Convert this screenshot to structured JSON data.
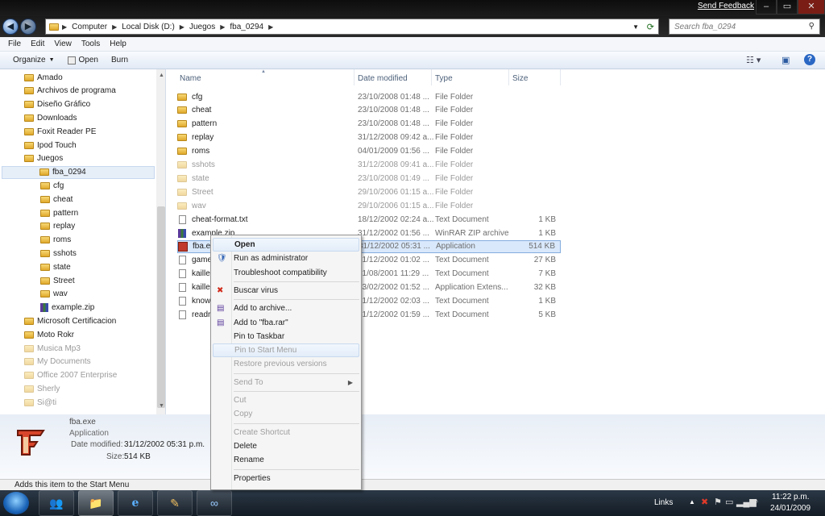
{
  "window": {
    "feedback": "Send Feedback",
    "controls": [
      "–",
      "▭",
      "✕"
    ]
  },
  "address": {
    "crumbs": [
      "Computer",
      "Local Disk (D:)",
      "Juegos",
      "fba_0294"
    ],
    "search_placeholder": "Search fba_0294"
  },
  "menu": [
    "File",
    "Edit",
    "View",
    "Tools",
    "Help"
  ],
  "toolbar": {
    "organize": "Organize",
    "open": "Open",
    "burn": "Burn"
  },
  "nav": [
    {
      "label": "Amado",
      "depth": 0
    },
    {
      "label": "Archivos de programa",
      "depth": 0
    },
    {
      "label": "Diseño Gráfico",
      "depth": 0
    },
    {
      "label": "Downloads",
      "depth": 0
    },
    {
      "label": "Foxit Reader PE",
      "depth": 0
    },
    {
      "label": "Ipod Touch",
      "depth": 0
    },
    {
      "label": "Juegos",
      "depth": 0
    },
    {
      "label": "fba_0294",
      "depth": 1,
      "selected": true
    },
    {
      "label": "cfg",
      "depth": 2
    },
    {
      "label": "cheat",
      "depth": 2
    },
    {
      "label": "pattern",
      "depth": 2
    },
    {
      "label": "replay",
      "depth": 2
    },
    {
      "label": "roms",
      "depth": 2
    },
    {
      "label": "sshots",
      "depth": 2
    },
    {
      "label": "state",
      "depth": 2
    },
    {
      "label": "Street",
      "depth": 2
    },
    {
      "label": "wav",
      "depth": 2
    },
    {
      "label": "example.zip",
      "depth": 2,
      "zip": true
    },
    {
      "label": "Microsoft Certificacion",
      "depth": 0
    },
    {
      "label": "Moto Rokr",
      "depth": 0
    },
    {
      "label": "Musica Mp3",
      "depth": 0,
      "dim": true
    },
    {
      "label": "My Documents",
      "depth": 0,
      "dim": true
    },
    {
      "label": "Office 2007 Enterprise",
      "depth": 0,
      "dim": true
    },
    {
      "label": "Sherly",
      "depth": 0,
      "dim": true
    },
    {
      "label": "Si@ti",
      "depth": 0,
      "dim": true
    }
  ],
  "columns": {
    "name": "Name",
    "date": "Date modified",
    "type": "Type",
    "size": "Size"
  },
  "files": [
    {
      "name": "cfg",
      "date": "23/10/2008 01:48 ...",
      "type": "File Folder",
      "size": "",
      "kind": "folder"
    },
    {
      "name": "cheat",
      "date": "23/10/2008 01:48 ...",
      "type": "File Folder",
      "size": "",
      "kind": "folder"
    },
    {
      "name": "pattern",
      "date": "23/10/2008 01:48 ...",
      "type": "File Folder",
      "size": "",
      "kind": "folder"
    },
    {
      "name": "replay",
      "date": "31/12/2008 09:42 a...",
      "type": "File Folder",
      "size": "",
      "kind": "folder"
    },
    {
      "name": "roms",
      "date": "04/01/2009 01:56 ...",
      "type": "File Folder",
      "size": "",
      "kind": "folder"
    },
    {
      "name": "sshots",
      "date": "31/12/2008 09:41 a...",
      "type": "File Folder",
      "size": "",
      "kind": "folder",
      "dim": true
    },
    {
      "name": "state",
      "date": "23/10/2008 01:49 ...",
      "type": "File Folder",
      "size": "",
      "kind": "folder",
      "dim": true
    },
    {
      "name": "Street",
      "date": "29/10/2006 01:15 a...",
      "type": "File Folder",
      "size": "",
      "kind": "folder",
      "dim": true
    },
    {
      "name": "wav",
      "date": "29/10/2006 01:15 a...",
      "type": "File Folder",
      "size": "",
      "kind": "folder",
      "dim": true
    },
    {
      "name": "cheat-format.txt",
      "date": "18/12/2002 02:24 a...",
      "type": "Text Document",
      "size": "1 KB",
      "kind": "doc"
    },
    {
      "name": "example.zip",
      "date": "31/12/2002 01:56 ...",
      "type": "WinRAR ZIP archive",
      "size": "1 KB",
      "kind": "zip"
    },
    {
      "name": "fba.e",
      "date": "31/12/2002 05:31 ...",
      "type": "Application",
      "size": "514 KB",
      "kind": "app",
      "selected": true
    },
    {
      "name": "game",
      "date": "31/12/2002 01:02 ...",
      "type": "Text Document",
      "size": "27 KB",
      "kind": "doc"
    },
    {
      "name": "kaille",
      "date": "31/08/2001 11:29 ...",
      "type": "Text Document",
      "size": "7 KB",
      "kind": "doc"
    },
    {
      "name": "kaille",
      "date": "23/02/2002 01:52 ...",
      "type": "Application Extens...",
      "size": "32 KB",
      "kind": "doc"
    },
    {
      "name": "know",
      "date": "31/12/2002 02:03 ...",
      "type": "Text Document",
      "size": "1 KB",
      "kind": "doc"
    },
    {
      "name": "readr",
      "date": "31/12/2002 01:59 ...",
      "type": "Text Document",
      "size": "5 KB",
      "kind": "doc"
    }
  ],
  "context_menu": [
    {
      "label": "Open",
      "bold": true,
      "hover": true
    },
    {
      "label": "Run as administrator",
      "icon": "shield"
    },
    {
      "label": "Troubleshoot compatibility"
    },
    {
      "sep": true
    },
    {
      "label": "Buscar virus",
      "icon": "virus"
    },
    {
      "sep": true
    },
    {
      "label": "Add to archive...",
      "icon": "rar"
    },
    {
      "label": "Add to \"fba.rar\"",
      "icon": "rar"
    },
    {
      "label": "Pin to Taskbar"
    },
    {
      "label": "Pin to Start Menu",
      "disabled": true,
      "hover": true
    },
    {
      "label": "Restore previous versions",
      "disabled": true
    },
    {
      "sep": true
    },
    {
      "label": "Send To",
      "disabled": true,
      "submenu": true
    },
    {
      "sep": true
    },
    {
      "label": "Cut",
      "disabled": true
    },
    {
      "label": "Copy",
      "disabled": true
    },
    {
      "sep": true
    },
    {
      "label": "Create Shortcut",
      "disabled": true
    },
    {
      "label": "Delete"
    },
    {
      "label": "Rename"
    },
    {
      "sep": true
    },
    {
      "label": "Properties"
    }
  ],
  "details": {
    "filename": "fba.exe",
    "type": "Application",
    "date_label": "Date modified:",
    "date_value": "31/12/2002 05:31 p.m.",
    "size_label": "Size:",
    "size_value": "514 KB"
  },
  "status": "Adds this item to the Start Menu",
  "taskbar": {
    "links": "Links",
    "time": "11:22 p.m.",
    "date": "24/01/2009"
  }
}
